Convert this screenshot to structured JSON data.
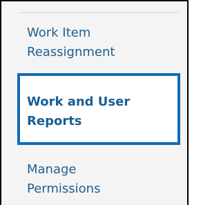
{
  "menu": {
    "items": [
      {
        "label": "Work Item\nReassignment",
        "selected": false
      },
      {
        "label": "Work and User\nReports",
        "selected": true
      },
      {
        "label": "Manage\nPermissions",
        "selected": false
      }
    ],
    "colors": {
      "link_text": "#1f5f8f",
      "selected_border": "#0f6cb6",
      "panel_background": "#f4f4f4",
      "selected_background": "#ffffff"
    }
  }
}
